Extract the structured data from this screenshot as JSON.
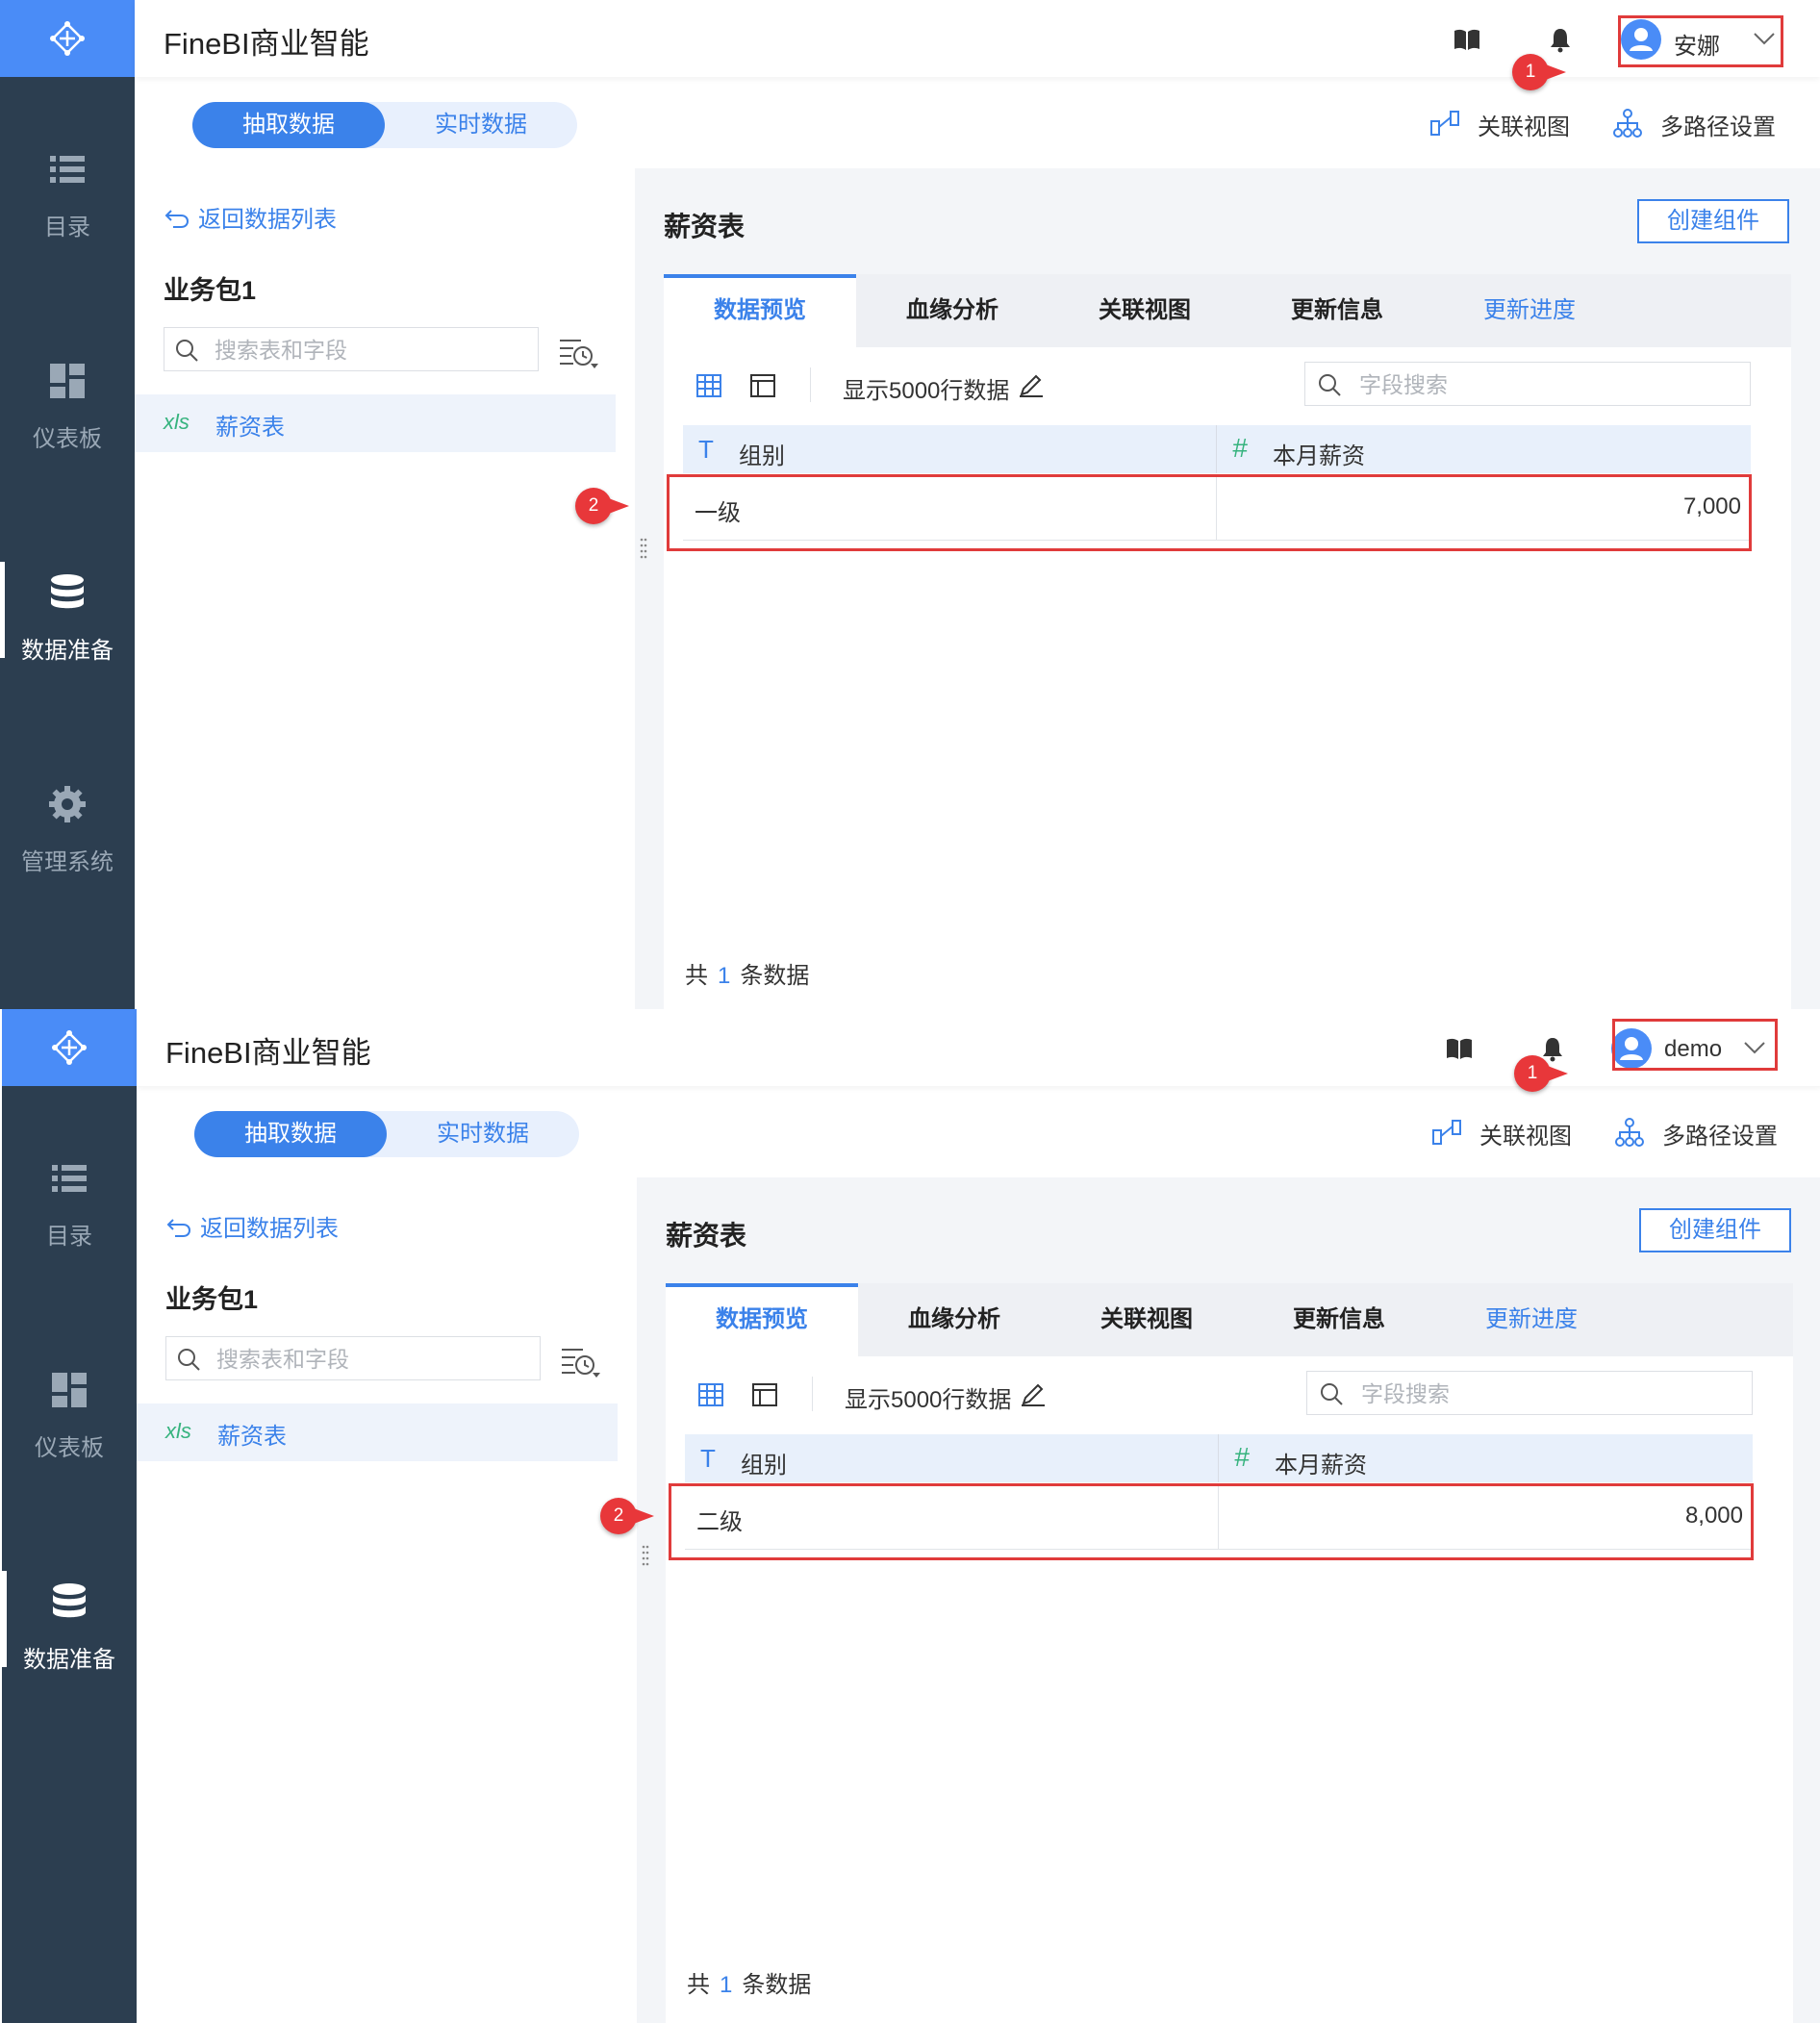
{
  "panels": [
    {
      "app_title": "FineBI商业智能",
      "user": {
        "name": "安娜"
      },
      "badge_user": "1",
      "badge_row": "2",
      "sidebar": {
        "items": [
          {
            "label": "目录",
            "icon": "list-icon"
          },
          {
            "label": "仪表板",
            "icon": "dashboard-icon"
          },
          {
            "label": "数据准备",
            "icon": "database-icon",
            "active": true
          },
          {
            "label": "管理系统",
            "icon": "gear-icon"
          }
        ]
      },
      "toggle": {
        "extract": "抽取数据",
        "realtime": "实时数据"
      },
      "top_links": {
        "relation_view": "关联视图",
        "multipath": "多路径设置"
      },
      "left": {
        "back": "返回数据列表",
        "package": "业务包1",
        "search_placeholder": "搜索表和字段",
        "tables": [
          {
            "type": "xls",
            "name": "薪资表"
          }
        ]
      },
      "main": {
        "title": "薪资表",
        "create_button": "创建组件",
        "tabs": [
          "数据预览",
          "血缘分析",
          "关联视图",
          "更新信息",
          "更新进度"
        ],
        "rows_label": "显示5000行数据",
        "field_search_placeholder": "字段搜索",
        "columns": [
          {
            "type": "T",
            "name": "组别"
          },
          {
            "type": "#",
            "name": "本月薪资"
          }
        ],
        "rows": [
          [
            "一级",
            "7,000"
          ]
        ],
        "footer": {
          "prefix": "共",
          "count": "1",
          "suffix": "条数据"
        }
      }
    },
    {
      "app_title": "FineBI商业智能",
      "user": {
        "name": "demo"
      },
      "badge_user": "1",
      "badge_row": "2",
      "sidebar": {
        "items": [
          {
            "label": "目录",
            "icon": "list-icon"
          },
          {
            "label": "仪表板",
            "icon": "dashboard-icon"
          },
          {
            "label": "数据准备",
            "icon": "database-icon",
            "active": true
          }
        ]
      },
      "toggle": {
        "extract": "抽取数据",
        "realtime": "实时数据"
      },
      "top_links": {
        "relation_view": "关联视图",
        "multipath": "多路径设置"
      },
      "left": {
        "back": "返回数据列表",
        "package": "业务包1",
        "search_placeholder": "搜索表和字段",
        "tables": [
          {
            "type": "xls",
            "name": "薪资表"
          }
        ]
      },
      "main": {
        "title": "薪资表",
        "create_button": "创建组件",
        "tabs": [
          "数据预览",
          "血缘分析",
          "关联视图",
          "更新信息",
          "更新进度"
        ],
        "rows_label": "显示5000行数据",
        "field_search_placeholder": "字段搜索",
        "columns": [
          {
            "type": "T",
            "name": "组别"
          },
          {
            "type": "#",
            "name": "本月薪资"
          }
        ],
        "rows": [
          [
            "二级",
            "8,000"
          ]
        ],
        "footer": {
          "prefix": "共",
          "count": "1",
          "suffix": "条数据"
        }
      }
    }
  ],
  "colors": {
    "brand": "#4a8cf7",
    "sidebar": "#2c3e50",
    "highlight": "#e03b3b",
    "accent": "#3b82ea"
  }
}
